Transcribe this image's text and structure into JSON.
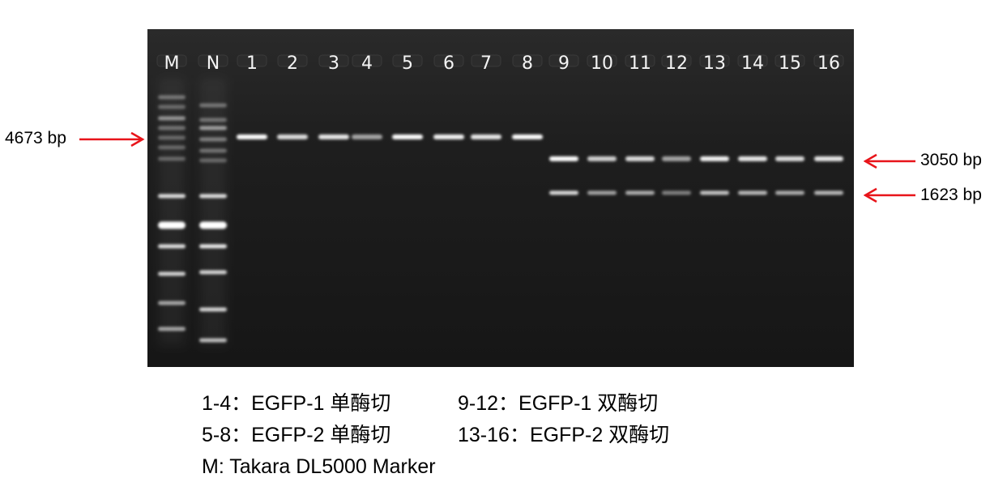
{
  "gel": {
    "lanes": [
      "M",
      "N",
      "1",
      "2",
      "3",
      "4",
      "5",
      "6",
      "7",
      "8",
      "9",
      "10",
      "11",
      "12",
      "13",
      "14",
      "15",
      "16"
    ]
  },
  "markers": {
    "left": "4673 bp",
    "right_upper": "3050 bp",
    "right_lower": "1623 bp"
  },
  "legend": {
    "row1_col1": "1-4：EGFP-1 单酶切",
    "row1_col2": "9-12：EGFP-1 双酶切",
    "row2_col1": "5-8：EGFP-2 单酶切",
    "row2_col2": "13-16：EGFP-2 双酶切",
    "row3": "M: Takara DL5000 Marker"
  },
  "colors": {
    "arrow": "#e8141a",
    "gel_background": "#1b1b1b",
    "band": "#ffffff"
  }
}
